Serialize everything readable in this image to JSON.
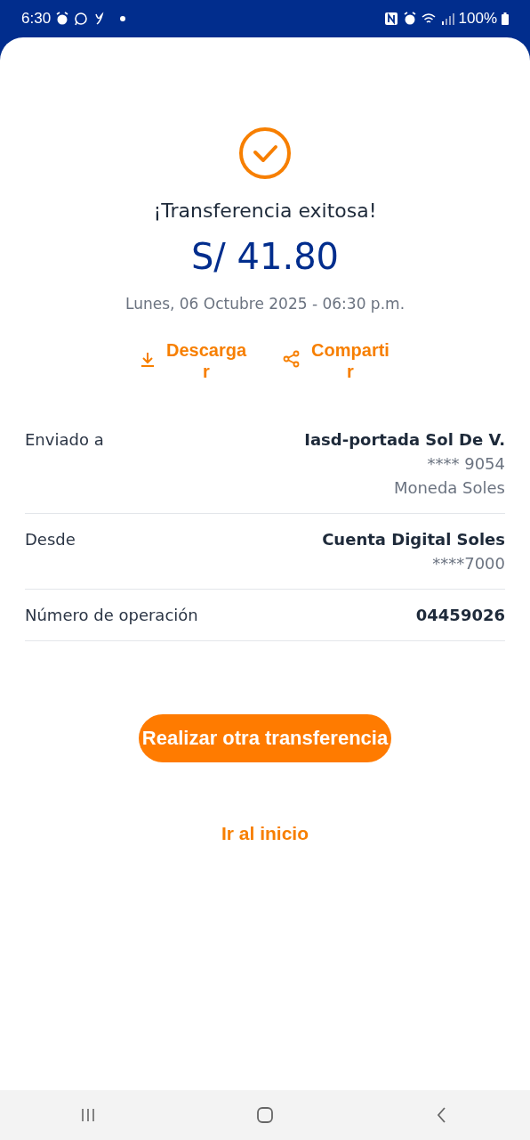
{
  "status_bar": {
    "time": "6:30",
    "battery": "100%"
  },
  "result": {
    "title": "¡Transferencia exitosa!",
    "amount": "S/ 41.80",
    "date": "Lunes, 06 Octubre 2025 - 06:30 p.m."
  },
  "actions": [
    {
      "kind": "download",
      "label": "Descargar"
    },
    {
      "kind": "share",
      "label": "Compartir"
    }
  ],
  "details": [
    {
      "label": "Enviado a",
      "lines": [
        "Iasd-portada Sol De V.",
        "**** 9054",
        "Moneda Soles"
      ]
    },
    {
      "label": "Desde",
      "lines": [
        "Cuenta Digital Soles",
        "****7000"
      ]
    },
    {
      "label": "Número de operación",
      "lines": [
        "04459026"
      ]
    }
  ],
  "primary_button": "Realizar otra transferencia",
  "link": "Ir al inicio"
}
